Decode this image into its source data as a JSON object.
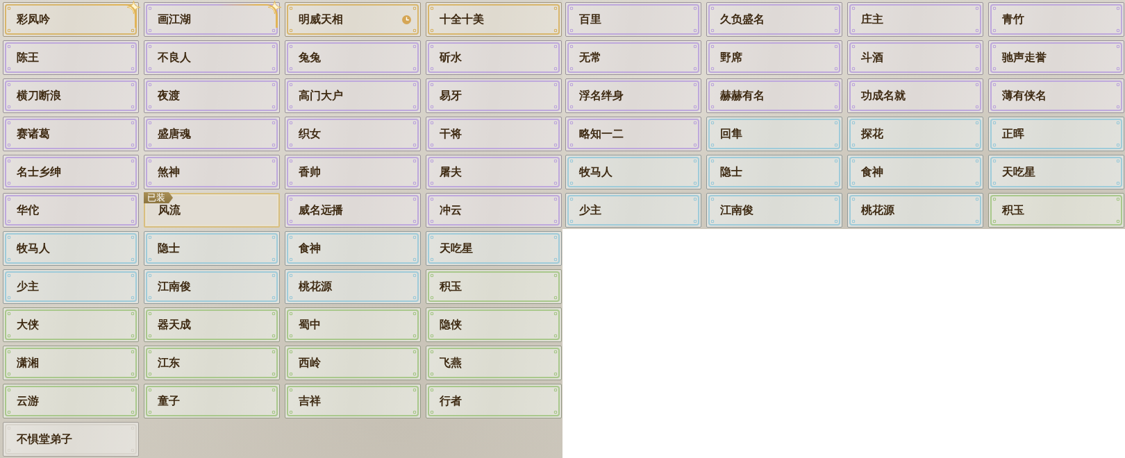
{
  "panels": [
    {
      "cards": [
        {
          "title": "彩凤吟",
          "color": "#d8b66c",
          "kind": "starred",
          "equipped": false
        },
        {
          "title": "画江湖",
          "color": "#bea8dc",
          "kind": "starred",
          "equipped": false
        },
        {
          "title": "明威天相",
          "color": "#d8b66c",
          "kind": "timed",
          "equipped": false
        },
        {
          "title": "十全十美",
          "color": "#d8b66c",
          "kind": "plain",
          "equipped": false
        },
        {
          "title": "陈王",
          "color": "#bea8dc",
          "kind": "plain",
          "equipped": false
        },
        {
          "title": "不良人",
          "color": "#bea8dc",
          "kind": "plain",
          "equipped": false
        },
        {
          "title": "兔兔",
          "color": "#bea8dc",
          "kind": "plain",
          "equipped": false
        },
        {
          "title": "斫水",
          "color": "#bea8dc",
          "kind": "plain",
          "equipped": false
        },
        {
          "title": "横刀断浪",
          "color": "#bea8dc",
          "kind": "plain",
          "equipped": false
        },
        {
          "title": "夜渡",
          "color": "#bea8dc",
          "kind": "plain",
          "equipped": false
        },
        {
          "title": "高门大户",
          "color": "#bea8dc",
          "kind": "plain",
          "equipped": false
        },
        {
          "title": "易牙",
          "color": "#bea8dc",
          "kind": "plain",
          "equipped": false
        },
        {
          "title": "赛诸葛",
          "color": "#bea8dc",
          "kind": "plain",
          "equipped": false
        },
        {
          "title": "盛唐魂",
          "color": "#bea8dc",
          "kind": "plain",
          "equipped": false
        },
        {
          "title": "织女",
          "color": "#bea8dc",
          "kind": "plain",
          "equipped": false
        },
        {
          "title": "干将",
          "color": "#bea8dc",
          "kind": "plain",
          "equipped": false
        },
        {
          "title": "名士乡绅",
          "color": "#bea8dc",
          "kind": "plain",
          "equipped": false
        },
        {
          "title": "煞神",
          "color": "#bea8dc",
          "kind": "plain",
          "equipped": false
        },
        {
          "title": "香帅",
          "color": "#bea8dc",
          "kind": "plain",
          "equipped": false
        },
        {
          "title": "屠夫",
          "color": "#bea8dc",
          "kind": "plain",
          "equipped": false
        },
        {
          "title": "华佗",
          "color": "#bea8dc",
          "kind": "plain",
          "equipped": false
        },
        {
          "title": "风流",
          "color": "#d9bf7e",
          "kind": "plain",
          "equipped": true,
          "badge": "已装"
        },
        {
          "title": "威名远播",
          "color": "#bea8dc",
          "kind": "plain",
          "equipped": false
        },
        {
          "title": "冲云",
          "color": "#bea8dc",
          "kind": "plain",
          "equipped": false
        },
        {
          "title": "牧马人",
          "color": "#9fcbd9",
          "kind": "plain",
          "equipped": false
        },
        {
          "title": "隐士",
          "color": "#9fcbd9",
          "kind": "plain",
          "equipped": false
        },
        {
          "title": "食神",
          "color": "#9fcbd9",
          "kind": "plain",
          "equipped": false
        },
        {
          "title": "天吃星",
          "color": "#9fcbd9",
          "kind": "plain",
          "equipped": false
        },
        {
          "title": "少主",
          "color": "#9fcbd9",
          "kind": "plain",
          "equipped": false
        },
        {
          "title": "江南俊",
          "color": "#9fcbd9",
          "kind": "plain",
          "equipped": false
        },
        {
          "title": "桃花源",
          "color": "#9fcbd9",
          "kind": "plain",
          "equipped": false
        },
        {
          "title": "积玉",
          "color": "#a9c88c",
          "kind": "plain",
          "equipped": false
        },
        {
          "title": "大侠",
          "color": "#a9c88c",
          "kind": "plain",
          "equipped": false
        },
        {
          "title": "器天成",
          "color": "#a9c88c",
          "kind": "plain",
          "equipped": false
        },
        {
          "title": "蜀中",
          "color": "#a9c88c",
          "kind": "plain",
          "equipped": false
        },
        {
          "title": "隐侠",
          "color": "#a9c88c",
          "kind": "plain",
          "equipped": false
        },
        {
          "title": "潇湘",
          "color": "#a9c88c",
          "kind": "plain",
          "equipped": false
        },
        {
          "title": "江东",
          "color": "#a9c88c",
          "kind": "plain",
          "equipped": false
        },
        {
          "title": "西岭",
          "color": "#a9c88c",
          "kind": "plain",
          "equipped": false
        },
        {
          "title": "飞燕",
          "color": "#a9c88c",
          "kind": "plain",
          "equipped": false
        },
        {
          "title": "云游",
          "color": "#a9c88c",
          "kind": "plain",
          "equipped": false
        },
        {
          "title": "童子",
          "color": "#a9c88c",
          "kind": "plain",
          "equipped": false
        },
        {
          "title": "吉祥",
          "color": "#a9c88c",
          "kind": "plain",
          "equipped": false
        },
        {
          "title": "行者",
          "color": "#a9c88c",
          "kind": "plain",
          "equipped": false
        },
        {
          "title": "不惧堂弟子",
          "color": "#d8d4cc",
          "kind": "plain",
          "equipped": false
        }
      ]
    },
    {
      "cards": [
        {
          "title": "百里",
          "color": "#bea8dc",
          "kind": "plain",
          "equipped": false
        },
        {
          "title": "久负盛名",
          "color": "#bea8dc",
          "kind": "plain",
          "equipped": false
        },
        {
          "title": "庄主",
          "color": "#bea8dc",
          "kind": "plain",
          "equipped": false
        },
        {
          "title": "青竹",
          "color": "#bea8dc",
          "kind": "plain",
          "equipped": false
        },
        {
          "title": "无常",
          "color": "#bea8dc",
          "kind": "plain",
          "equipped": false
        },
        {
          "title": "野席",
          "color": "#bea8dc",
          "kind": "plain",
          "equipped": false
        },
        {
          "title": "斗酒",
          "color": "#bea8dc",
          "kind": "plain",
          "equipped": false
        },
        {
          "title": "驰声走誉",
          "color": "#bea8dc",
          "kind": "plain",
          "equipped": false
        },
        {
          "title": "浮名绊身",
          "color": "#bea8dc",
          "kind": "plain",
          "equipped": false
        },
        {
          "title": "赫赫有名",
          "color": "#bea8dc",
          "kind": "plain",
          "equipped": false
        },
        {
          "title": "功成名就",
          "color": "#bea8dc",
          "kind": "plain",
          "equipped": false
        },
        {
          "title": "薄有侠名",
          "color": "#bea8dc",
          "kind": "plain",
          "equipped": false
        },
        {
          "title": "略知一二",
          "color": "#bea8dc",
          "kind": "plain",
          "equipped": false
        },
        {
          "title": "回隼",
          "color": "#9fcbd9",
          "kind": "plain",
          "equipped": false
        },
        {
          "title": "探花",
          "color": "#9fcbd9",
          "kind": "plain",
          "equipped": false
        },
        {
          "title": "正晖",
          "color": "#9fcbd9",
          "kind": "plain",
          "equipped": false
        },
        {
          "title": "牧马人",
          "color": "#9fcbd9",
          "kind": "plain",
          "equipped": false
        },
        {
          "title": "隐士",
          "color": "#9fcbd9",
          "kind": "plain",
          "equipped": false
        },
        {
          "title": "食神",
          "color": "#9fcbd9",
          "kind": "plain",
          "equipped": false
        },
        {
          "title": "天吃星",
          "color": "#9fcbd9",
          "kind": "plain",
          "equipped": false
        },
        {
          "title": "少主",
          "color": "#9fcbd9",
          "kind": "plain",
          "equipped": false
        },
        {
          "title": "江南俊",
          "color": "#9fcbd9",
          "kind": "plain",
          "equipped": false
        },
        {
          "title": "桃花源",
          "color": "#9fcbd9",
          "kind": "plain",
          "equipped": false
        },
        {
          "title": "积玉",
          "color": "#a9c88c",
          "kind": "plain",
          "equipped": false
        }
      ]
    }
  ]
}
